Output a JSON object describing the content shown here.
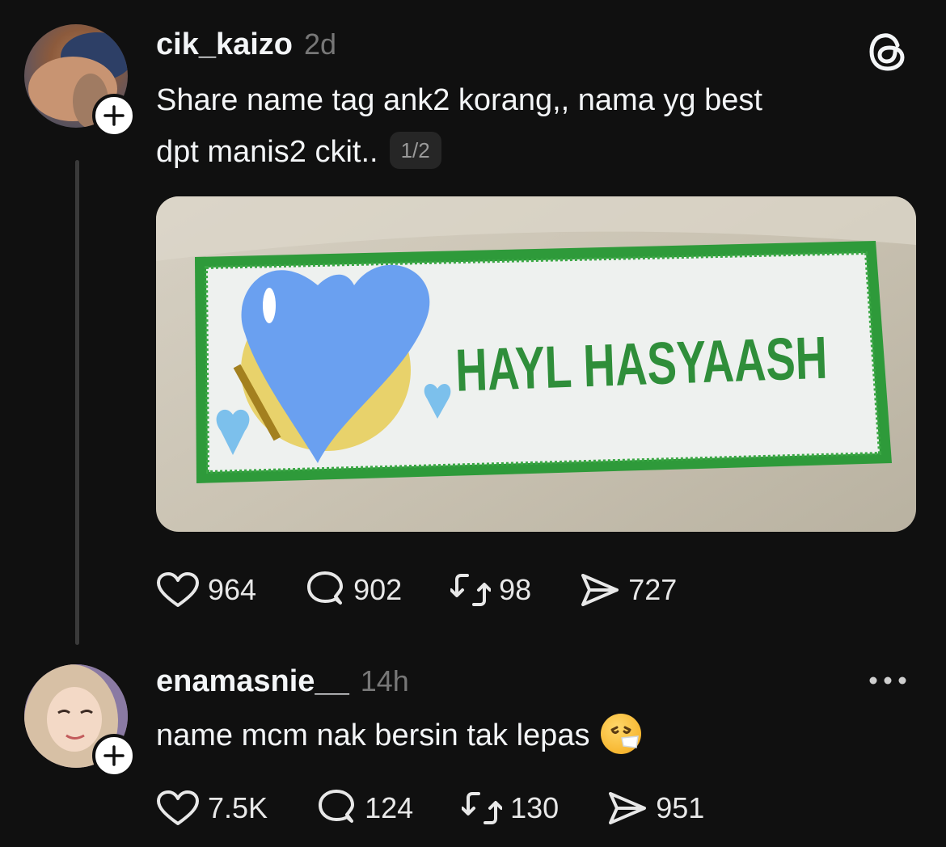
{
  "post": {
    "username": "cik_kaizo",
    "time": "2d",
    "text_line1": "Share name tag ank2 korang,, nama yg best",
    "text_line2": "dpt manis2 ckit..",
    "page_indicator": "1/2",
    "image": {
      "nametag_text": "HAYL HASYAASH",
      "border_color": "#2e9a3a",
      "sticker_color": "#6aa0f0"
    },
    "actions": {
      "likes": "964",
      "replies": "902",
      "reposts": "98",
      "shares": "727"
    }
  },
  "reply": {
    "username": "enamasnie__",
    "time": "14h",
    "text": "name mcm nak bersin tak lepas",
    "emoji_icon": "sneezing-face-icon",
    "actions": {
      "likes": "7.5K",
      "replies": "124",
      "reposts": "130",
      "shares": "951"
    }
  },
  "icons": {
    "logo": "threads-logo-icon",
    "like": "heart-icon",
    "reply": "comment-icon",
    "repost": "repost-icon",
    "share": "send-icon",
    "follow": "plus-icon",
    "more": "more-options-icon"
  }
}
